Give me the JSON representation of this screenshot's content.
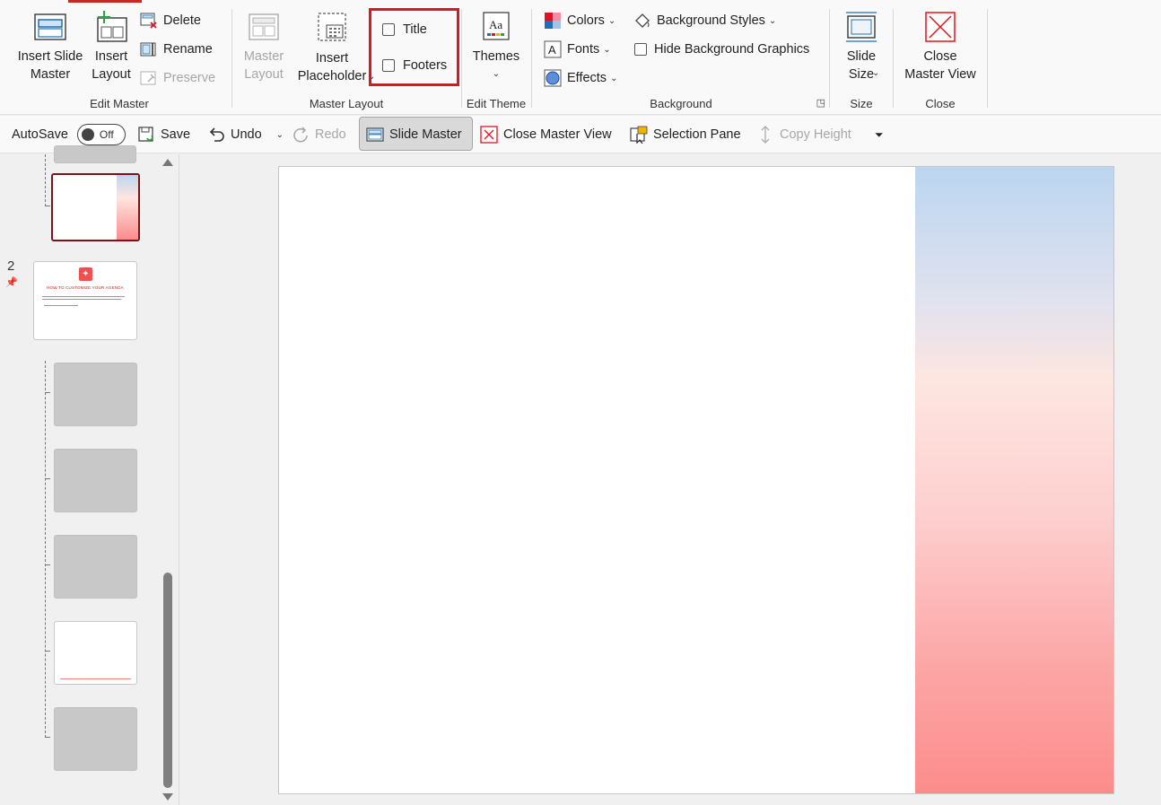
{
  "ribbon": {
    "edit_master": {
      "label": "Edit Master",
      "insert_slide_master": "Insert Slide\nMaster",
      "insert_layout": "Insert\nLayout",
      "delete": "Delete",
      "rename": "Rename",
      "preserve": "Preserve"
    },
    "master_layout": {
      "label": "Master Layout",
      "master_layout_btn": "Master\nLayout",
      "insert_placeholder": "Insert\nPlaceholder",
      "title_checkbox": "Title",
      "footers_checkbox": "Footers"
    },
    "edit_theme": {
      "label": "Edit Theme",
      "themes": "Themes"
    },
    "background": {
      "label": "Background",
      "colors": "Colors",
      "fonts": "Fonts",
      "effects": "Effects",
      "background_styles": "Background Styles",
      "hide_background_graphics": "Hide Background Graphics"
    },
    "size": {
      "label": "Size",
      "slide_size": "Slide\nSize"
    },
    "close": {
      "label": "Close",
      "close_master_view": "Close\nMaster View"
    }
  },
  "qat": {
    "autosave": "AutoSave",
    "autosave_state": "Off",
    "save": "Save",
    "undo": "Undo",
    "redo": "Redo",
    "slide_master": "Slide Master",
    "close_master_view": "Close Master View",
    "selection_pane": "Selection Pane",
    "copy_height": "Copy Height"
  },
  "thumbnails": {
    "slide_number": "2",
    "slide2_title": "HOW TO CUSTOMIZE YOUR AGENDA"
  },
  "colors": {
    "accent_red": "#e0141e",
    "selected_thumb_border": "#7a1418",
    "band_top": "#bcd5f0",
    "band_bottom": "#fc8c8c"
  }
}
